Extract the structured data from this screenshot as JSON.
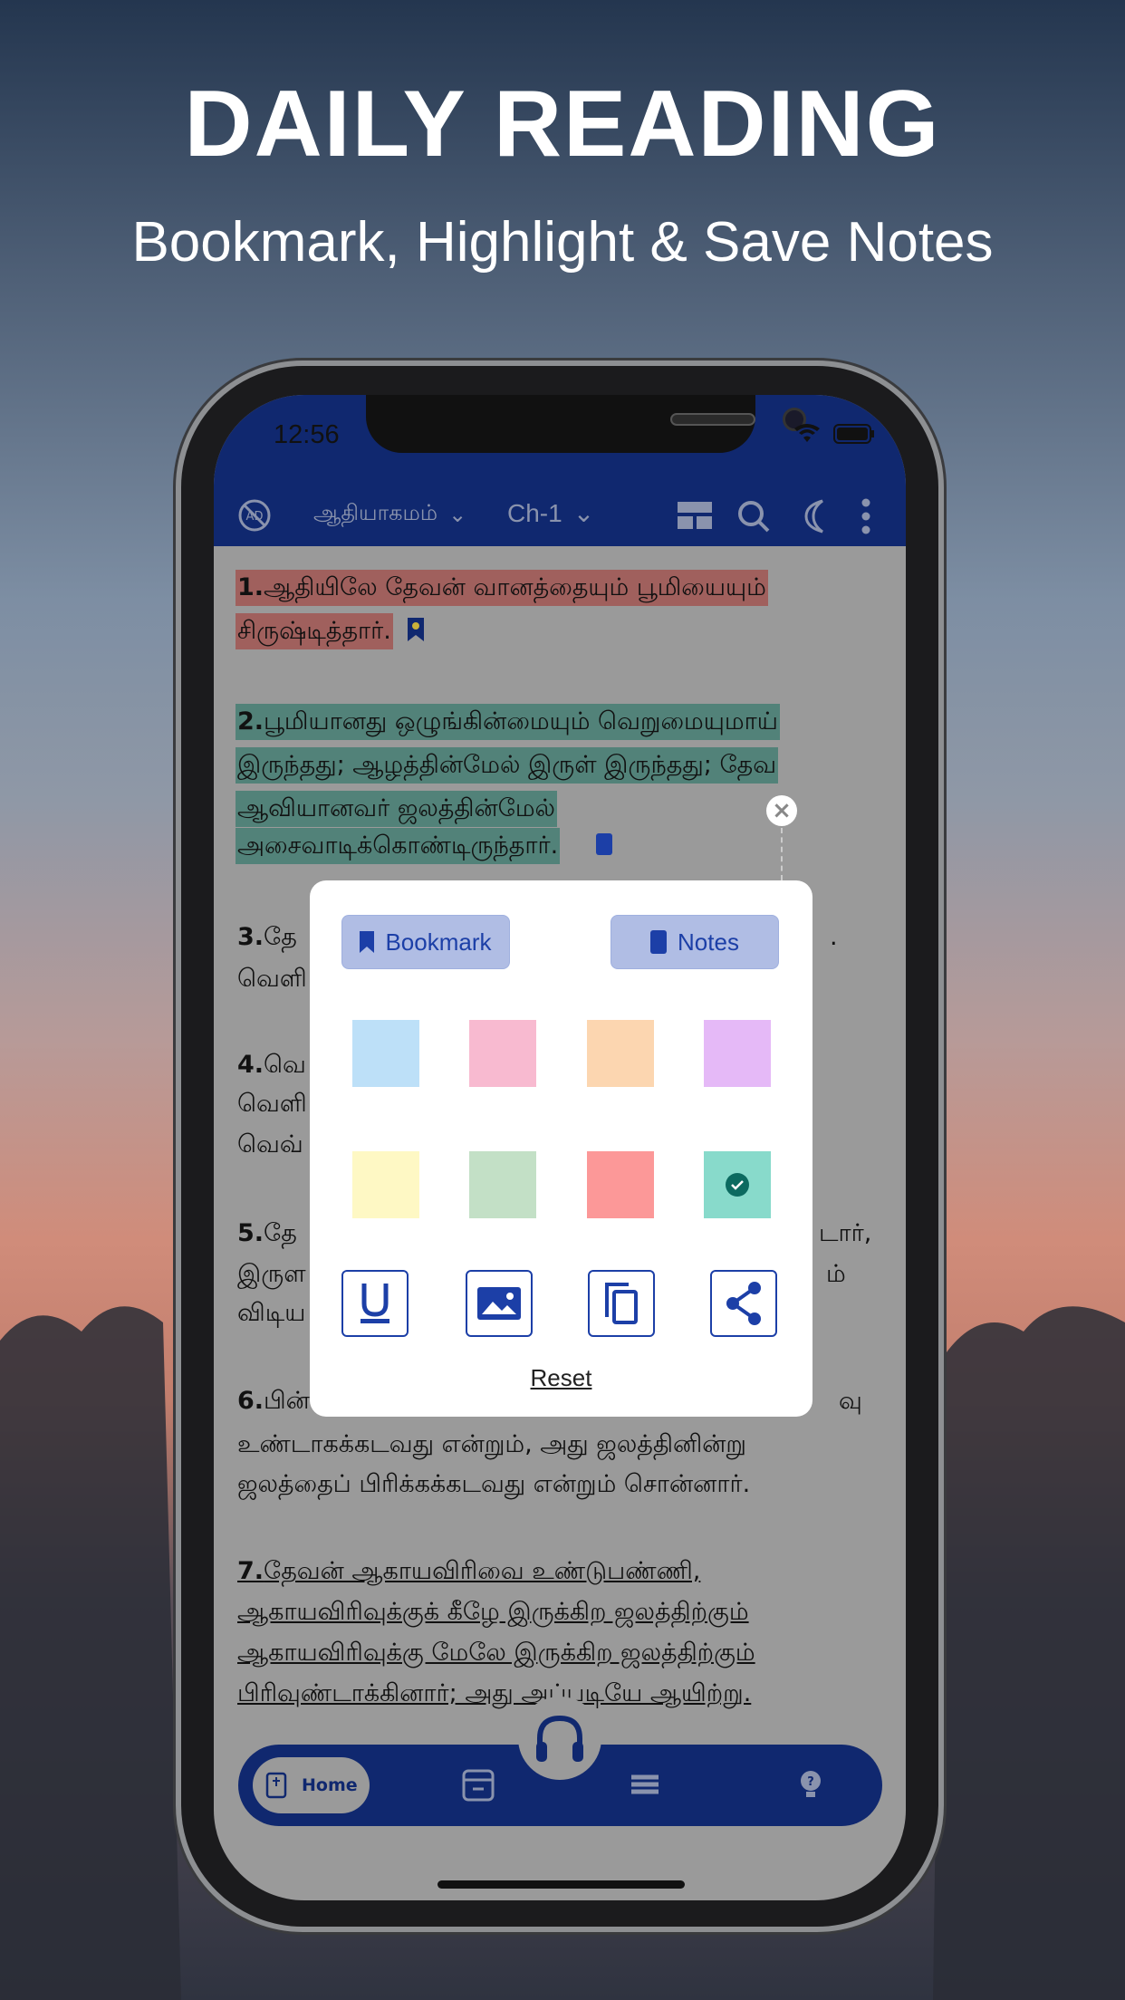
{
  "hero": {
    "title": "DAILY READING",
    "subtitle": "Bookmark, Highlight & Save Notes"
  },
  "status": {
    "time": "12:56"
  },
  "nav": {
    "book": "ஆதியாகமம்",
    "chapter": "Ch-1",
    "icons": [
      "no-ads-icon",
      "layout-icon",
      "search-icon",
      "moon-icon",
      "more-icon"
    ]
  },
  "verses": [
    {
      "num": "1.",
      "lines": [
        "ஆதியிலே தேவன் வானத்தையும் பூமியையும்",
        "சிருஷ்டித்தார்."
      ],
      "highlight": "#a0605d",
      "bookmarked": true
    },
    {
      "num": "2.",
      "lines": [
        "பூமியானது ஒழுங்கின்மையும் வெறுமையுமாய்",
        "இருந்தது; ஆழத்தின்மேல் இருள் இருந்தது; தேவ",
        "ஆவியானவர் ஜலத்தின்மேல்",
        "அசைவாடிக்கொண்டிருந்தார்."
      ],
      "highlight": "#528279",
      "has_note": true
    },
    {
      "num": "3.",
      "lines": [
        "தே",
        "வெளி"
      ],
      "right": [
        "."
      ]
    },
    {
      "num": "4.",
      "lines": [
        "வெ",
        "வெளி",
        "வெவ்"
      ]
    },
    {
      "num": "5.",
      "lines": [
        "தே",
        "இருள",
        "விடிய"
      ],
      "right": [
        "டார்,",
        "ம்"
      ]
    },
    {
      "num": "6.",
      "lines": [
        "பின்",
        "உண்டாகக்கடவது என்றும், அது ஜலத்தினின்று",
        "ஜலத்தைப் பிரிக்கக்கடவது என்றும் சொன்னார்."
      ],
      "right": [
        "வு"
      ]
    },
    {
      "num": "7.",
      "lines": [
        "தேவன் ஆகாயவிரிவை உண்டுபண்ணி,",
        "ஆகாயவிரிவுக்குக் கீழே இருக்கிற ஜலத்திற்கும்",
        "ஆகாயவிரிவுக்கு மேலே இருக்கிற ஜலத்திற்கும்",
        "பிரிவுண்டாக்கினார்; அது அப்படியே ஆயிற்று."
      ],
      "underlined": true
    }
  ],
  "popup": {
    "bookmark": "Bookmark",
    "notes": "Notes",
    "reset": "Reset",
    "colors": [
      "#bde0f8",
      "#f8bad0",
      "#fcd6b0",
      "#e5b9f7",
      "#fef8c4",
      "#c3e0c6",
      "#fc9898",
      "#88dacb"
    ],
    "selected_color": "#88dacb",
    "actions": [
      "underline-icon",
      "image-icon",
      "copy-icon",
      "share-icon"
    ]
  },
  "bottom_nav": {
    "home": "Home",
    "items": [
      "home-bible-icon",
      "notes-card-icon",
      "books-icon",
      "quiz-bulb-icon"
    ],
    "center": "headphones-icon"
  },
  "accent": "#1c3fa7"
}
